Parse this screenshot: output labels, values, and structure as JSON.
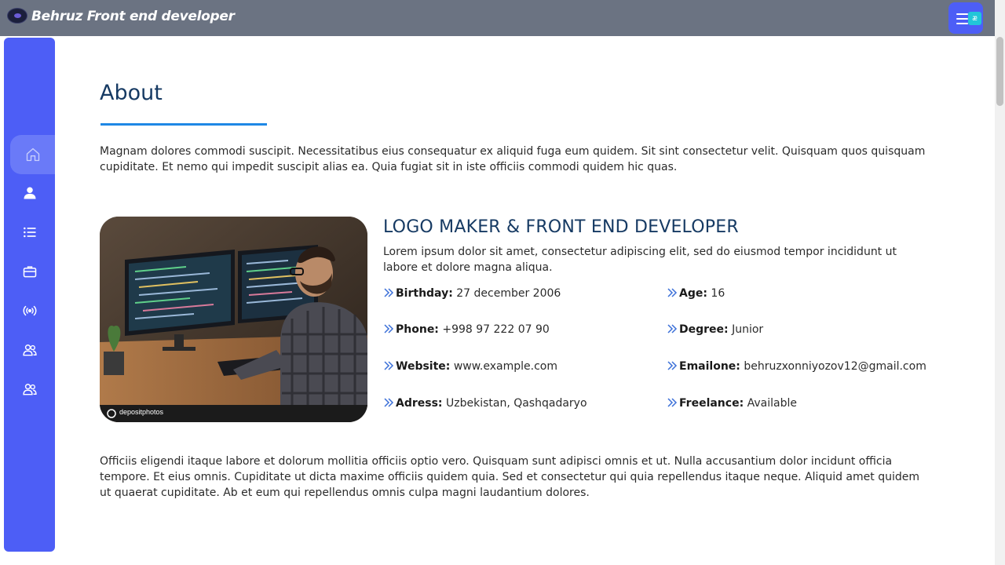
{
  "header": {
    "brand": "Behruz Front end developer",
    "logo_icon": "planet-logo-icon",
    "menu_icon": "hamburger-menu-icon",
    "extension_icon": "æ",
    "colors": {
      "bar": "#6b7382",
      "menu_button": "#4d5ef6"
    }
  },
  "sidebar": {
    "color": "#4d5ef6",
    "items": [
      {
        "icon": "home-icon",
        "active": true
      },
      {
        "icon": "user-icon",
        "active": false
      },
      {
        "icon": "list-icon",
        "active": false
      },
      {
        "icon": "briefcase-icon",
        "active": false
      },
      {
        "icon": "broadcast-icon",
        "active": false
      },
      {
        "icon": "users-icon",
        "active": false
      },
      {
        "icon": "users-icon",
        "active": false
      }
    ]
  },
  "about": {
    "title": "About",
    "intro": "Magnam dolores commodi suscipit. Necessitatibus eius consequatur ex aliquid fuga eum quidem. Sit sint consectetur velit. Quisquam quos quisquam cupiditate. Et nemo qui impedit suscipit alias ea. Quia fugiat sit in iste officiis commodi quidem hic quas.",
    "role": "LOGO MAKER & FRONT END DEVELOPER",
    "role_desc": "Lorem ipsum dolor sit amet, consectetur adipiscing elit, sed do eiusmod tempor incididunt ut labore et dolore magna aliqua.",
    "photo_alt": "developer at computer with code on two monitors",
    "photo_watermark": "depositphotos",
    "details": {
      "birthday_label": "Birthday:",
      "birthday": "27 december 2006",
      "age_label": "Age:",
      "age": "16",
      "phone_label": "Phone:",
      "phone": "+998 97 222 07 90",
      "degree_label": "Degree:",
      "degree": "Junior",
      "website_label": "Website:",
      "website": "www.example.com",
      "email_label": "Emailone:",
      "email": "behruzxonniyozov12@gmail.com",
      "address_label": "Adress:",
      "address": "Uzbekistan, Qashqadaryo",
      "freelance_label": "Freelance:",
      "freelance": "Available"
    },
    "outro": "Officiis eligendi itaque labore et dolorum mollitia officiis optio vero. Quisquam sunt adipisci omnis et ut. Nulla accusantium dolor incidunt officia tempore. Et eius omnis. Cupiditate ut dicta maxime officiis quidem quia. Sed et consectetur qui quia repellendus itaque neque. Aliquid amet quidem ut quaerat cupiditate. Ab et eum qui repellendus omnis culpa magni laudantium dolores."
  }
}
